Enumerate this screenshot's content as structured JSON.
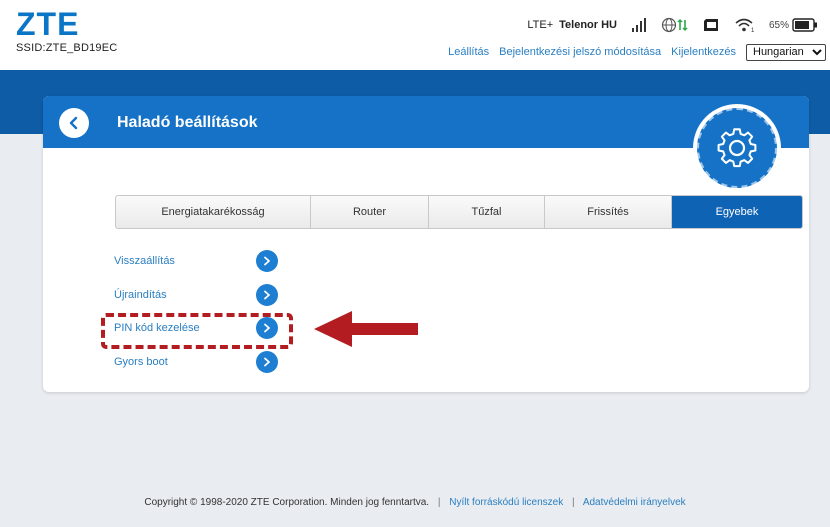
{
  "header": {
    "logo": "ZTE",
    "ssid": "SSID:ZTE_BD19EC",
    "network_type": "LTE+",
    "carrier": "Telenor HU",
    "battery_percent": "65%",
    "links": {
      "shutdown": "Leállítás",
      "change_password": "Bejelentkezési jelszó módosítása",
      "logout": "Kijelentkezés"
    },
    "language": "Hungarian"
  },
  "card": {
    "title": "Haladó beállítások",
    "tabs": [
      {
        "label": "Energiatakarékosság",
        "active": false
      },
      {
        "label": "Router",
        "active": false
      },
      {
        "label": "Tűzfal",
        "active": false
      },
      {
        "label": "Frissítés",
        "active": false
      },
      {
        "label": "Egyebek",
        "active": true
      }
    ],
    "menu_items": [
      {
        "label": "Visszaállítás"
      },
      {
        "label": "Újraindítás"
      },
      {
        "label": "PIN kód kezelése"
      },
      {
        "label": "Gyors boot"
      }
    ]
  },
  "footer": {
    "copyright": "Copyright © 1998-2020 ZTE Corporation. Minden jog fenntartva.",
    "license_link": "Nyílt forráskódú licenszek",
    "privacy_link": "Adatvédelmi irányelvek"
  },
  "colors": {
    "brand_blue": "#0b76c5",
    "header_band": "#0f5ca6",
    "active_tab": "#0f63b4",
    "annotation_red": "#b31d21"
  },
  "icons": [
    "signal-bars-icon",
    "globe-data-icon",
    "sim-card-icon",
    "wifi-icon",
    "battery-icon",
    "back-chevron-icon",
    "gear-icon",
    "chevron-right-icon",
    "red-arrow-icon"
  ]
}
